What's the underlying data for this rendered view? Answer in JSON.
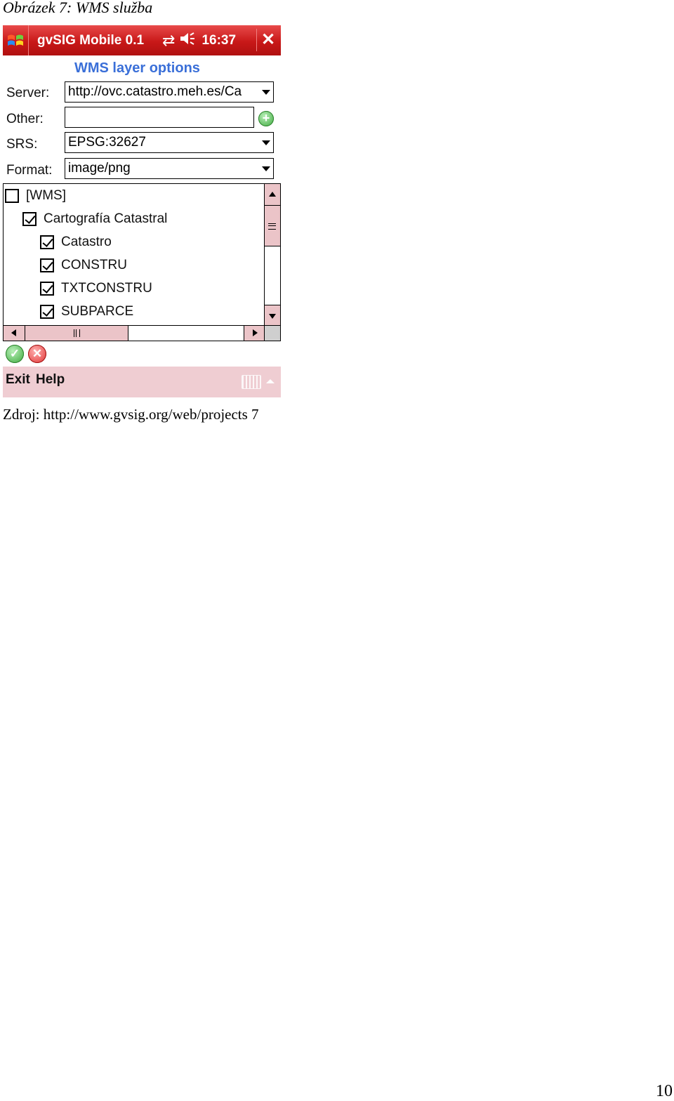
{
  "caption": "Obrázek 7: WMS služba",
  "source": "Zdroj: http://www.gvsig.org/web/projects 7",
  "page_number": "10",
  "titlebar": {
    "app_title": "gvSIG Mobile 0.1",
    "time": "16:37",
    "close_label": "✕",
    "connectivity_icon": "⇄",
    "volume_icon": "🔈",
    "start_icon": "windows-flag-icon"
  },
  "dialog": {
    "title": "WMS layer options",
    "server_label": "Server:",
    "server_value": "http://ovc.catastro.meh.es/Ca",
    "other_label": "Other:",
    "other_value": "",
    "srs_label": "SRS:",
    "srs_value": "EPSG:32627",
    "format_label": "Format:",
    "format_value": "image/png",
    "add_label": "+"
  },
  "tree": {
    "items": [
      {
        "label": "[WMS]",
        "checked": false,
        "level": 0
      },
      {
        "label": "Cartografía Catastral",
        "checked": true,
        "level": 1
      },
      {
        "label": "Catastro",
        "checked": true,
        "level": 2
      },
      {
        "label": "CONSTRU",
        "checked": true,
        "level": 2
      },
      {
        "label": "TXTCONSTRU",
        "checked": true,
        "level": 2
      },
      {
        "label": "SUBPARCE",
        "checked": true,
        "level": 2
      }
    ]
  },
  "actions": {
    "ok_label": "✓",
    "cancel_label": "✕"
  },
  "softkeys": {
    "exit_label": "Exit",
    "help_label": "Help"
  },
  "colors": {
    "titlebar": "#c81818",
    "accent_blue": "#3a6fd8",
    "softkey_bar": "#efcdd2",
    "scroll_pink": "#ebc4c8"
  }
}
